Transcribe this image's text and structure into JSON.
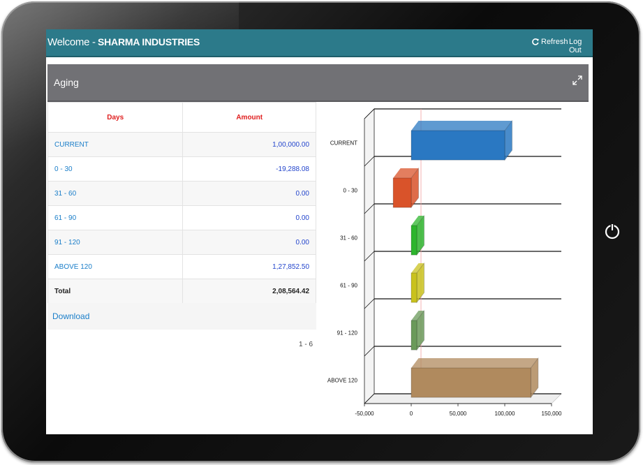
{
  "header": {
    "welcome": "Welcome -",
    "company": "SHARMA INDUSTRIES",
    "refresh": "Refresh",
    "logout": "Log Out"
  },
  "panel": {
    "title": "Aging"
  },
  "table": {
    "headers": [
      "Days",
      "Amount"
    ],
    "rows": [
      {
        "days": "CURRENT",
        "amount": "1,00,000.00"
      },
      {
        "days": "0 - 30",
        "amount": "-19,288.08"
      },
      {
        "days": "31 - 60",
        "amount": "0.00"
      },
      {
        "days": "61 - 90",
        "amount": "0.00"
      },
      {
        "days": "91 - 120",
        "amount": "0.00"
      },
      {
        "days": "ABOVE 120",
        "amount": "1,27,852.50"
      }
    ],
    "total_label": "Total",
    "total_amount": "2,08,564.42"
  },
  "download": "Download",
  "pager": "1 - 6",
  "chart_data": {
    "type": "bar",
    "orientation": "horizontal",
    "three_d": true,
    "categories": [
      "CURRENT",
      "0 - 30",
      "31 - 60",
      "61 - 90",
      "91 - 120",
      "ABOVE 120"
    ],
    "values": [
      100000,
      -19288.08,
      0,
      0,
      0,
      127852.5
    ],
    "colors": [
      "#2a78c2",
      "#d9532a",
      "#2db52d",
      "#c9c21e",
      "#6a9a5a",
      "#b08a5e"
    ],
    "xlim": [
      -50000,
      150000
    ],
    "xticks": [
      "-50,000",
      "0",
      "50,000",
      "100,000",
      "150,000"
    ],
    "grid": true
  }
}
